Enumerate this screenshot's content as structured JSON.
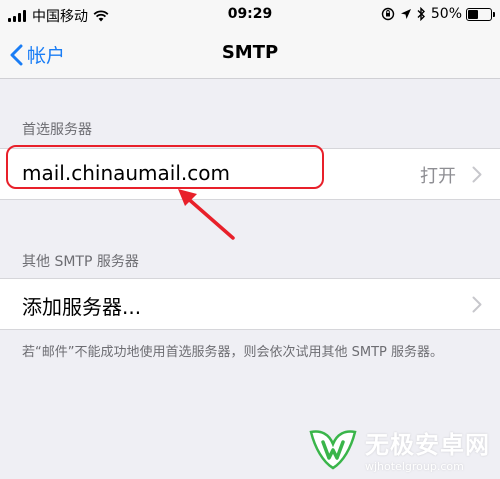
{
  "status_bar": {
    "carrier": "中国移动",
    "time": "09:29",
    "battery_text": "50%",
    "battery_level": 0.5
  },
  "nav": {
    "back_label": "帐户",
    "title": "SMTP"
  },
  "primary_section": {
    "header": "首选服务器",
    "server": "mail.chinaumail.com",
    "status": "打开"
  },
  "other_section": {
    "header": "其他 SMTP 服务器",
    "add_label": "添加服务器...",
    "footer": "若“邮件”不能成功地使用首选服务器，则会依次试用其他 SMTP 服务器。"
  },
  "watermark": {
    "name": "无极安卓网",
    "url": "wjhotelgroup.com"
  },
  "colors": {
    "accent": "#1a7df5",
    "annotation": "#e8202a",
    "background": "#efeff4",
    "watermark_green": "#3ab54a"
  },
  "icons": [
    "signal-icon",
    "wifi-icon",
    "orientation-lock-icon",
    "location-icon",
    "bluetooth-icon",
    "battery-icon",
    "back-chevron-icon",
    "chevron-right-icon",
    "red-arrow-icon",
    "watermark-logo-icon"
  ]
}
